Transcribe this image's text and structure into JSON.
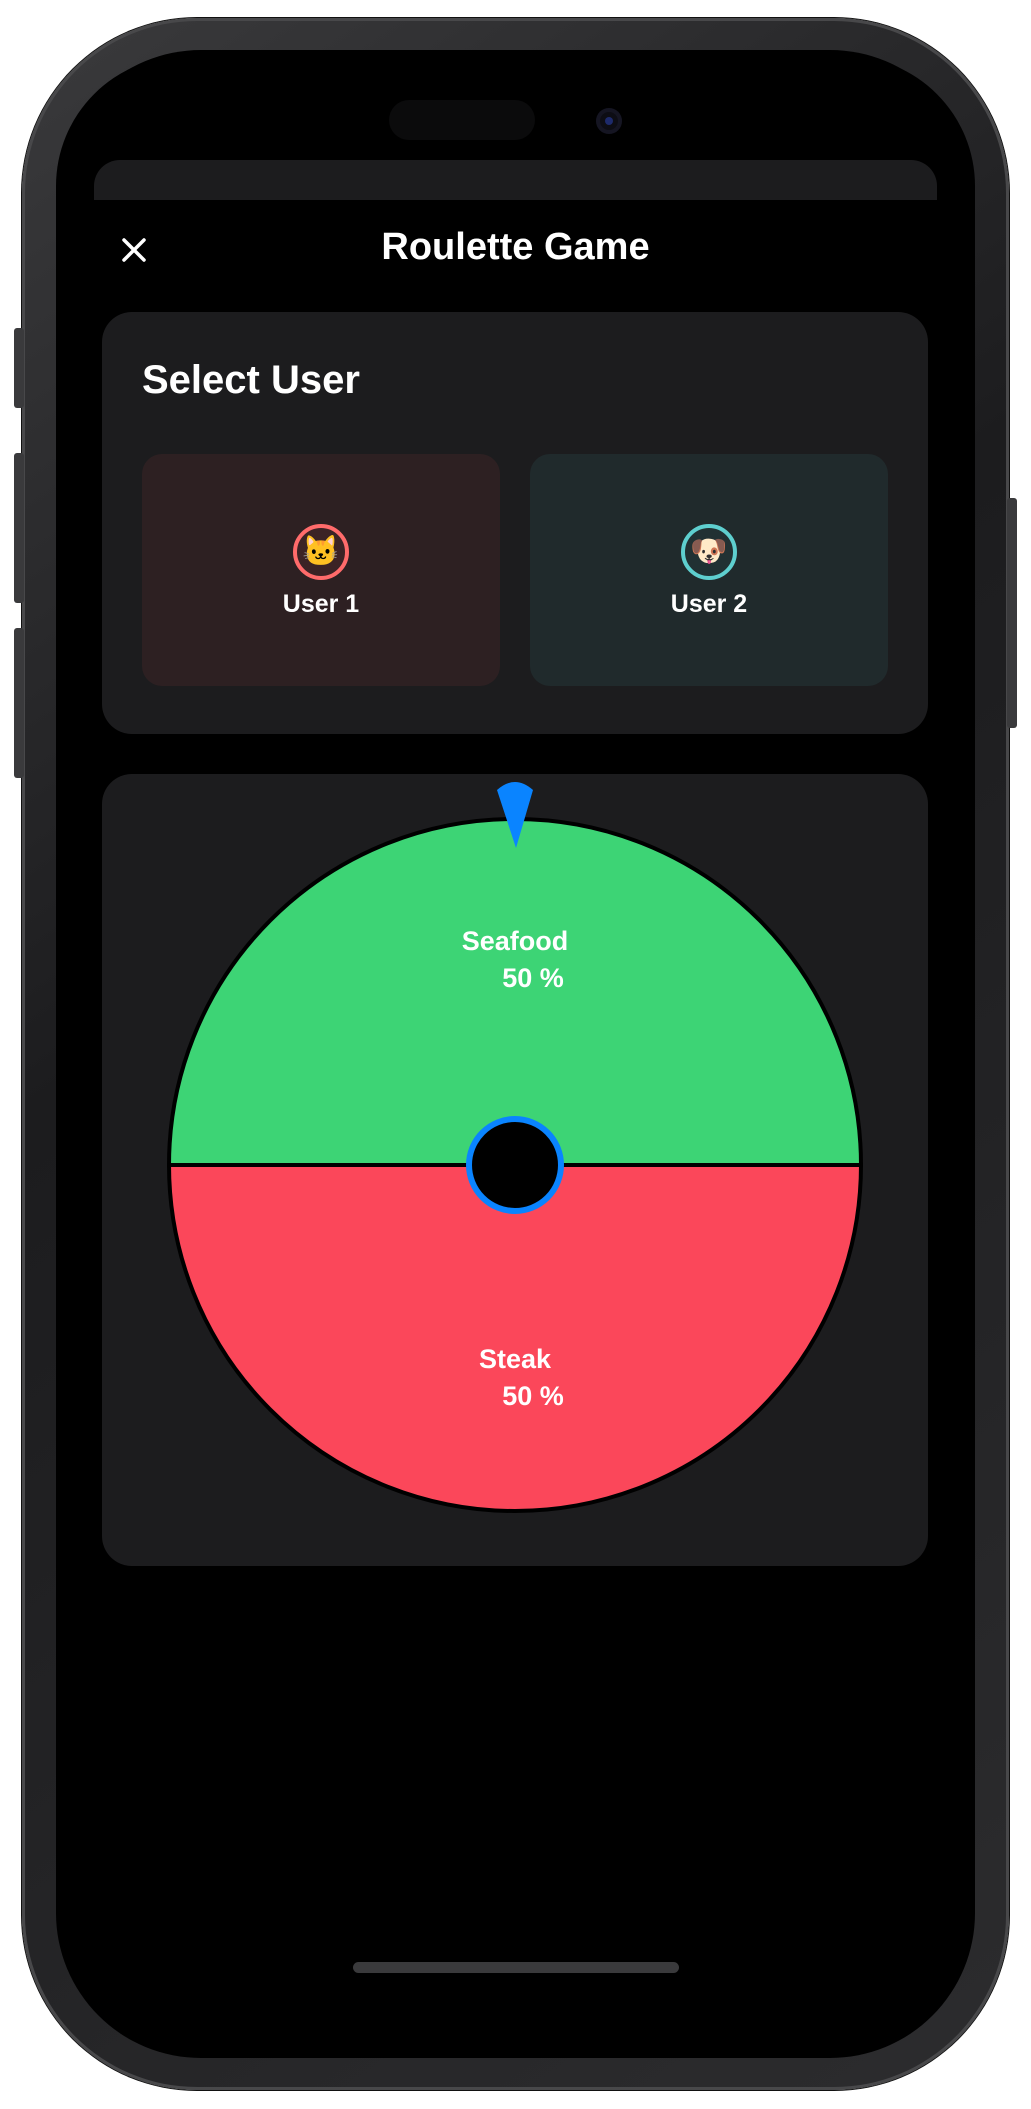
{
  "header": {
    "title": "Roulette Game",
    "close_icon": "close-icon"
  },
  "user_select": {
    "title": "Select User",
    "users": [
      {
        "label": "User 1",
        "avatar": "🐱",
        "accent": "#ff6b6b"
      },
      {
        "label": "User 2",
        "avatar": "🐶",
        "accent": "#5ecfcf"
      }
    ]
  },
  "roulette": {
    "pointer_color": "#0a84ff",
    "segments": [
      {
        "label": "Seafood",
        "percent": "50 %",
        "value": 50,
        "color": "#3dd475"
      },
      {
        "label": "Steak",
        "percent": "50 %",
        "value": 50,
        "color": "#fb475a"
      }
    ]
  }
}
